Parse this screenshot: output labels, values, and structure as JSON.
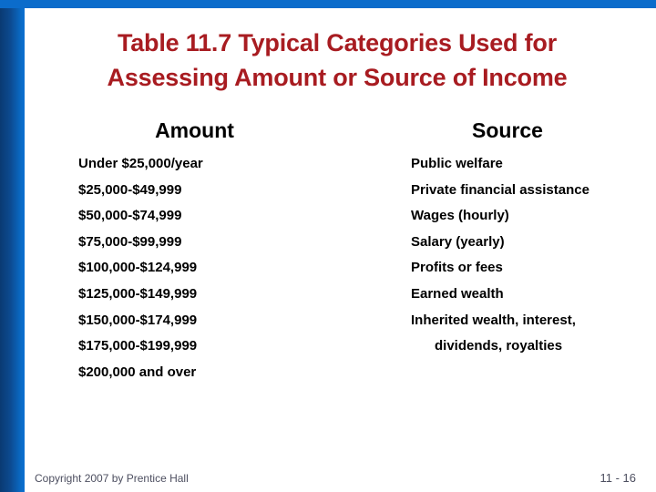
{
  "slide": {
    "title_line1": "Table 11.7 Typical Categories Used for",
    "title_line2": "Assessing Amount or Source of Income",
    "title_color": "#a81c21",
    "accent_blue": "#0b6ccb",
    "band_dark_blue": "#0a3a72"
  },
  "table": {
    "headers": {
      "amount": "Amount",
      "source": "Source"
    },
    "amount_rows": [
      "Under $25,000/year",
      "$25,000-$49,999",
      "$50,000-$74,999",
      "$75,000-$99,999",
      "$100,000-$124,999",
      "$125,000-$149,999",
      "$150,000-$174,999",
      "$175,000-$199,999",
      "$200,000 and over"
    ],
    "source_rows": [
      "Public welfare",
      "Private financial assistance",
      "Wages (hourly)",
      "Salary (yearly)",
      "Profits or fees",
      "Earned wealth"
    ],
    "source_last": {
      "line1": "Inherited wealth, interest,",
      "line2": "dividends, royalties"
    }
  },
  "footer": {
    "copyright": "Copyright 2007 by Prentice Hall",
    "page_number": "11 - 16"
  }
}
